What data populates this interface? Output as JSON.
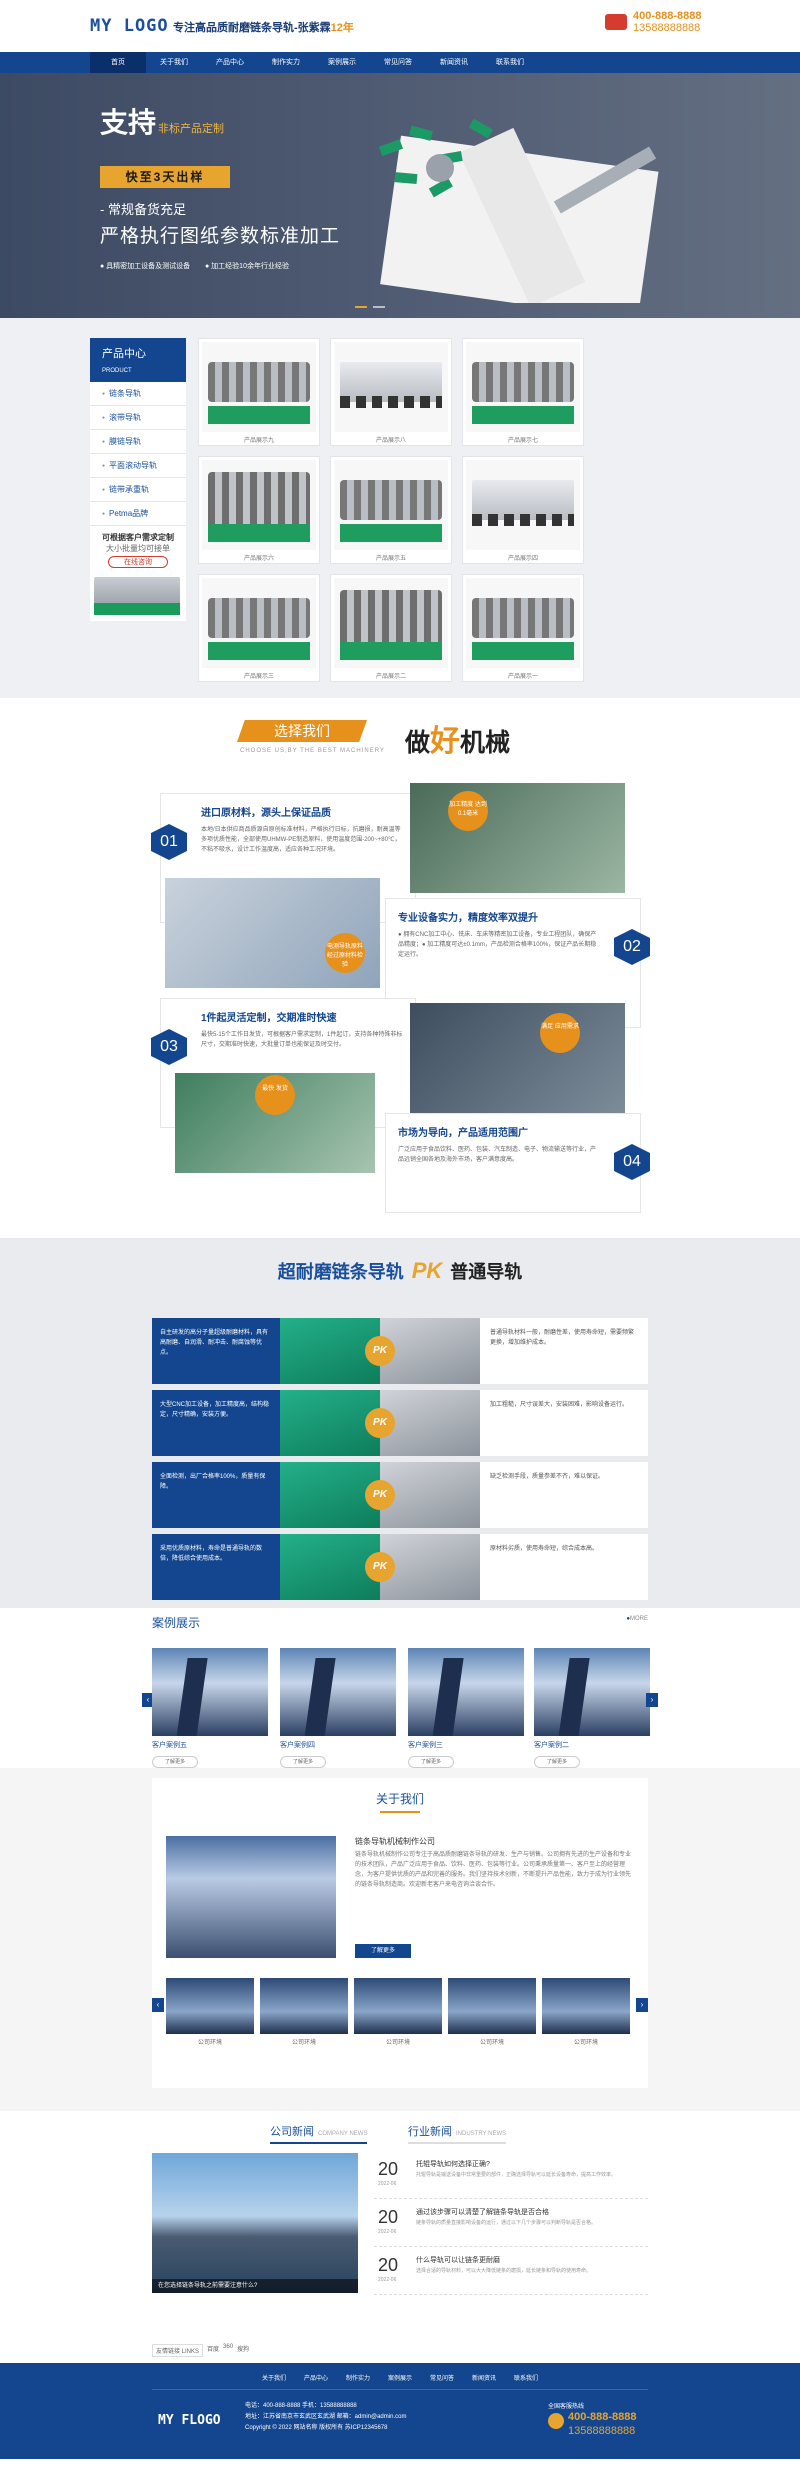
{
  "header": {
    "logo": "MY LOGO",
    "tagline": "专注高品质耐磨链条导轨-张紫霖",
    "tagline_years": "12年",
    "phone_1": "400-888-8888",
    "phone_2": "13588888888"
  },
  "nav": [
    "首页",
    "关于我们",
    "产品中心",
    "制作实力",
    "案例展示",
    "常见问答",
    "新闻资讯",
    "联系我们"
  ],
  "banner": {
    "big": "支持",
    "small": "非标产品定制",
    "button": "快至3天出样",
    "line3": "- 常规备货充足",
    "line4": "严格执行图纸参数标准加工",
    "feat_1": "● 具精密加工设备及测试设备",
    "feat_2": "● 加工经验10余年行业经验"
  },
  "products": {
    "title": "产品中心",
    "title_en": "PRODUCT",
    "cats": [
      "链条导轨",
      "滚带导轨",
      "膜链导轨",
      "平面滚动导轨",
      "链带承重轨",
      "Petma品牌"
    ],
    "cta_1": "可根据客户需求定制",
    "cta_2": "大小批量均可接单",
    "cta_3": "在线咨询",
    "items": [
      "产品展示九",
      "产品展示八",
      "产品展示七",
      "产品展示六",
      "产品展示五",
      "产品展示四",
      "产品展示三",
      "产品展示二",
      "产品展示一"
    ]
  },
  "choose": {
    "badge": "选择我们",
    "sub": "CHOOSE US,BY THE BEST MACHINERY",
    "big_1": "做",
    "big_2": "好",
    "big_3": "机械",
    "f1_num": "01",
    "f1_title": "进口原材料，源头上保证品质",
    "f1_text": "本地/日本供应商品质源自原创标准材料，严格执行日标，抗磨损，耐高温等多项优质性能，全部使用UHMW-PE制造原料，使用温度范围-200~+80℃，不粘不吸水，设计工作温度高，适应各种工况环境。",
    "f1_badge": "电测导轨原料 经过原材料检验",
    "f2_num": "02",
    "f2_title": "专业设备实力，精度效率双提升",
    "f2_text": "● 拥有CNC加工中心、铣床、车床等精密加工设备，专业工程团队，确保产品精度；● 加工精度可达±0.1mm，产品检测合格率100%，保证产品长期稳定运行。",
    "f2_badge": "加工精度 达到0.1毫米",
    "f3_num": "03",
    "f3_title": "1件起灵活定制，交期准时快速",
    "f3_text": "最快5-15个工作日发货，可根据客户需求定制，1件起订，支持各种特殊非标尺寸，交期准时快速，大批量订单也能保证及时交付。",
    "f3_badge": "最快 发货",
    "f4_num": "04",
    "f4_title": "市场为导向，产品适用范围广",
    "f4_text": "广泛应用于食品饮料、医药、包装、汽车制造、电子、物流输送等行业，产品远销全国各地及海外市场，客户满意度高。",
    "f4_badge": "满足 应用需求"
  },
  "pk": {
    "title_1": "超耐磨链条导轨",
    "vs": "PK",
    "title_2": "普通导轨",
    "rows": [
      {
        "left": "自主研发的高分子量超级耐磨材料，具有高耐磨、自润滑、耐冲击、耐腐蚀等优点。",
        "right": "普通导轨材料一般，耐磨性差，使用寿命短，需要频繁更换，增加维护成本。"
      },
      {
        "left": "大型CNC加工设备，加工精度高，结构稳定，尺寸精确，安装方便。",
        "right": "加工粗糙，尺寸误差大，安装困难，影响设备运行。"
      },
      {
        "left": "全面检测，出厂合格率100%，质量有保障。",
        "right": "缺乏检测手段，质量参差不齐，难以保证。"
      },
      {
        "left": "采用优质原材料，寿命是普通导轨的数倍，降低综合使用成本。",
        "right": "原材料劣质，使用寿命短，综合成本高。"
      }
    ]
  },
  "cases": {
    "title": "案例展示",
    "more": "MORE",
    "items": [
      "客户案例五",
      "客户案例四",
      "客户案例三",
      "客户案例二"
    ],
    "btn": "了解更多"
  },
  "about": {
    "title": "关于我们",
    "company": "链条导轨机械制作公司",
    "text": "链条导轨机械制作公司专注于高品质耐磨链条导轨的研发、生产与销售。公司拥有先进的生产设备和专业的技术团队，产品广泛应用于食品、饮料、医药、包装等行业。公司秉承质量第一、客户至上的经营理念，为客户提供优质的产品和完善的服务。我们坚持技术创新，不断提升产品性能，致力于成为行业领先的链条导轨制造商。欢迎新老客户来电咨询洽谈合作。",
    "btn": "了解更多",
    "thumbs": [
      "公司环境",
      "公司环境",
      "公司环境",
      "公司环境",
      "公司环境"
    ]
  },
  "news": {
    "t1": "公司新闻",
    "t1_en": "COMPANY NEWS",
    "t2": "行业新闻",
    "t2_en": "INDUSTRY NEWS",
    "img_cap": "在您选择链条导轨之前需要注意什么?",
    "items": [
      {
        "day": "20",
        "ym": "2022-06",
        "title": "托辊导轨如何选择正确?",
        "sum": "托辊导轨是输送设备中非常重要的部件，正确选择导轨可以延长设备寿命，提高工作效率。"
      },
      {
        "day": "20",
        "ym": "2022-06",
        "title": "通过该步骤可以清楚了解链条导轨是否合格",
        "sum": "链条导轨的质量直接影响设备的运行，通过以下几个步骤可以判断导轨是否合格。"
      },
      {
        "day": "20",
        "ym": "2022-06",
        "title": "什么导轨可以让链条更耐磨",
        "sum": "选择合适的导轨材料，可以大大降低链条的磨损，延长链条和导轨的使用寿命。"
      }
    ],
    "links_label": "友情链接 LINKS",
    "links": [
      "百度",
      "360",
      "搜狗"
    ]
  },
  "footer": {
    "nav": [
      "关于我们",
      "产品中心",
      "制作实力",
      "案例展示",
      "常见问答",
      "新闻资讯",
      "联系我们"
    ],
    "logo": "MY FLOGO",
    "info_1": "电话：400-888-8888  手机：13588888888",
    "info_2": "地址：江苏省南京市玄武区玄武湖  邮箱：admin@admin.com",
    "info_3": "Copyright © 2022 网站名称 版权所有  苏ICP12345678",
    "hotline": "全国客服热线",
    "phone_1": "400-888-8888",
    "phone_2": "13588888888"
  }
}
